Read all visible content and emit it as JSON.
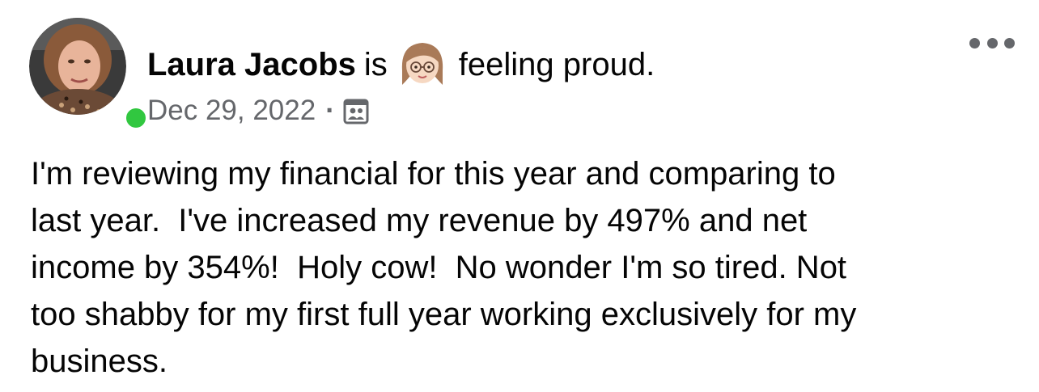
{
  "post": {
    "author_name": "Laura Jacobs",
    "is_word": "is",
    "feeling_text": "feeling proud.",
    "feeling_emoji": "woman-with-glasses-emoji",
    "date": "Dec 29, 2022",
    "separator": "·",
    "audience_icon": "friends-audience-icon",
    "online_status_color": "#31c740",
    "body_lines": [
      "I'm reviewing my financial for this year and comparing to",
      "last year.  I've increased my revenue by 497% and net",
      "income by 354%!  Holy cow!  No wonder I'm so tired. Not",
      "too shabby for my first full year working exclusively for my",
      "business."
    ]
  },
  "colors": {
    "primary_text": "#050505",
    "secondary_text": "#65676b",
    "online_green": "#31c740",
    "background": "#ffffff"
  }
}
